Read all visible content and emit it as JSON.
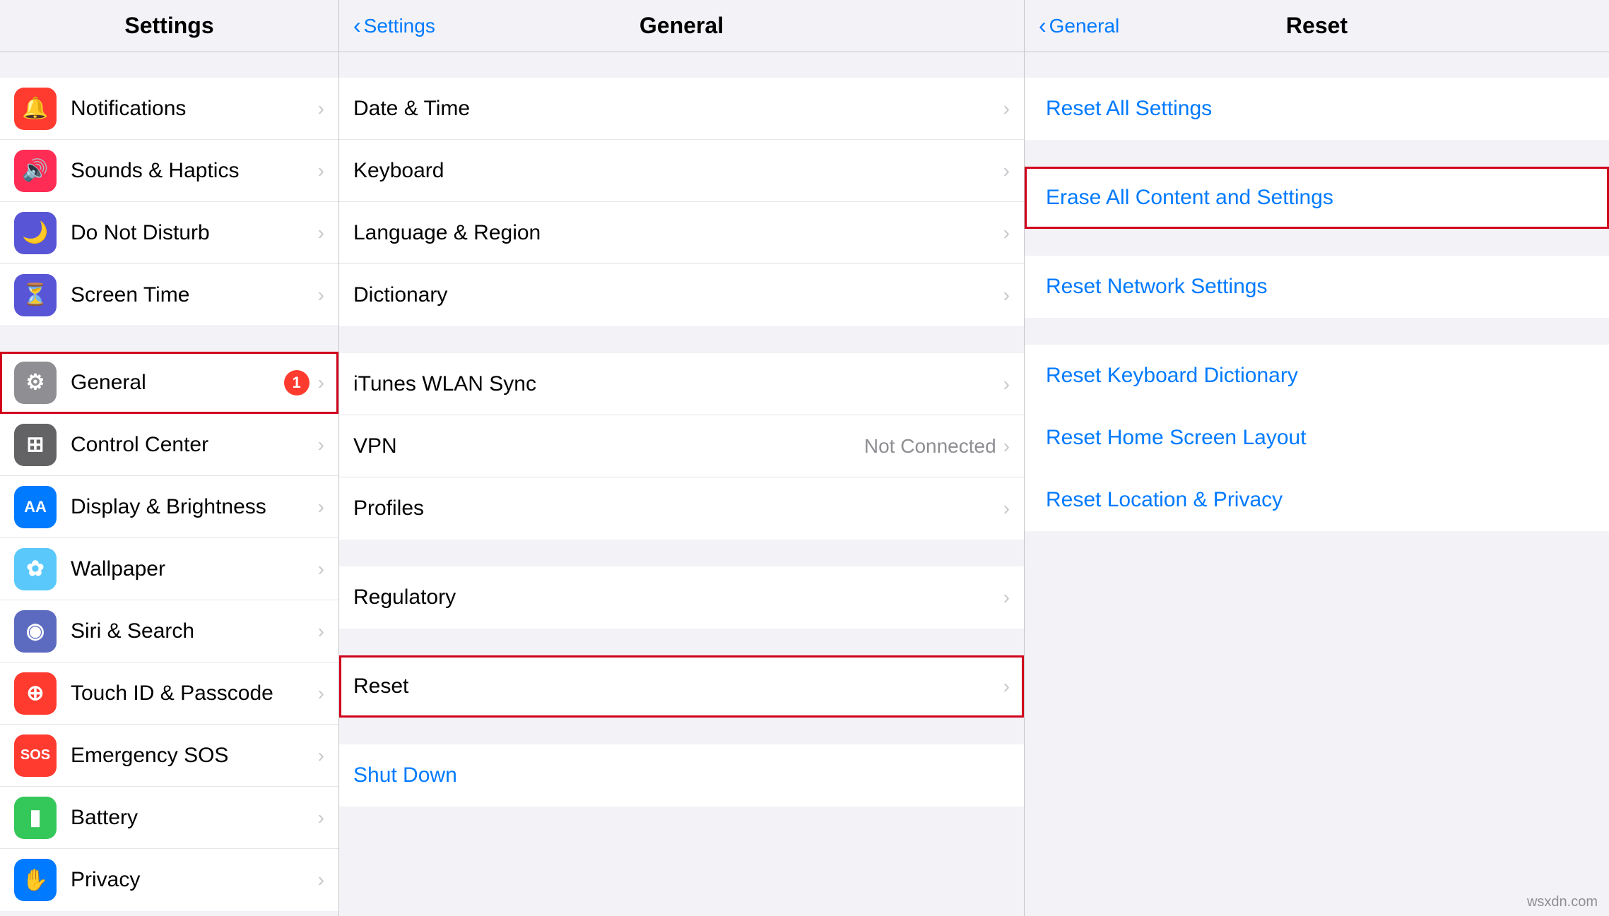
{
  "left_column": {
    "title": "Settings",
    "items": [
      {
        "id": "notifications",
        "label": "Notifications",
        "icon_color": "icon-red",
        "icon_char": "🔔",
        "badge": null,
        "selected": false
      },
      {
        "id": "sounds",
        "label": "Sounds & Haptics",
        "icon_color": "icon-pink",
        "icon_char": "🔊",
        "badge": null,
        "selected": false
      },
      {
        "id": "do-not-disturb",
        "label": "Do Not Disturb",
        "icon_color": "icon-indigo",
        "icon_char": "🌙",
        "badge": null,
        "selected": false
      },
      {
        "id": "screen-time",
        "label": "Screen Time",
        "icon_color": "icon-purple",
        "icon_char": "⏳",
        "badge": null,
        "selected": false
      },
      {
        "id": "general",
        "label": "General",
        "icon_color": "icon-gray",
        "icon_char": "⚙️",
        "badge": "1",
        "selected": true
      },
      {
        "id": "control-center",
        "label": "Control Center",
        "icon_color": "icon-dark-gray",
        "icon_char": "⚙",
        "badge": null,
        "selected": false
      },
      {
        "id": "display",
        "label": "Display & Brightness",
        "icon_color": "icon-blue",
        "icon_char": "AA",
        "badge": null,
        "selected": false
      },
      {
        "id": "wallpaper",
        "label": "Wallpaper",
        "icon_color": "icon-light-blue",
        "icon_char": "🌸",
        "badge": null,
        "selected": false
      },
      {
        "id": "siri",
        "label": "Siri & Search",
        "icon_color": "icon-dark-gray",
        "icon_char": "◉",
        "badge": null,
        "selected": false
      },
      {
        "id": "touch-id",
        "label": "Touch ID & Passcode",
        "icon_color": "icon-red",
        "icon_char": "☁",
        "badge": null,
        "selected": false
      },
      {
        "id": "emergency-sos",
        "label": "Emergency SOS",
        "icon_color": "icon-sos",
        "icon_char": "SOS",
        "badge": null,
        "selected": false
      },
      {
        "id": "battery",
        "label": "Battery",
        "icon_color": "icon-green",
        "icon_char": "▮",
        "badge": null,
        "selected": false
      },
      {
        "id": "privacy",
        "label": "Privacy",
        "icon_color": "icon-blue",
        "icon_char": "✋",
        "badge": null,
        "selected": false
      }
    ]
  },
  "middle_column": {
    "nav_back": "Settings",
    "title": "General",
    "items_top": [],
    "groups": [
      {
        "items": [
          {
            "id": "date-time",
            "label": "Date & Time",
            "value": "",
            "selected": false
          },
          {
            "id": "keyboard",
            "label": "Keyboard",
            "value": "",
            "selected": false
          },
          {
            "id": "language-region",
            "label": "Language & Region",
            "value": "",
            "selected": false
          },
          {
            "id": "dictionary",
            "label": "Dictionary",
            "value": "",
            "selected": false
          }
        ]
      },
      {
        "items": [
          {
            "id": "itunes-wlan",
            "label": "iTunes WLAN Sync",
            "value": "",
            "selected": false
          },
          {
            "id": "vpn",
            "label": "VPN",
            "value": "Not Connected",
            "selected": false
          },
          {
            "id": "profiles",
            "label": "Profiles",
            "value": "",
            "selected": false
          }
        ]
      },
      {
        "items": [
          {
            "id": "regulatory",
            "label": "Regulatory",
            "value": "",
            "selected": false
          }
        ]
      },
      {
        "items": [
          {
            "id": "reset",
            "label": "Reset",
            "value": "",
            "selected": true
          }
        ]
      }
    ],
    "bottom_items": [
      {
        "id": "shut-down",
        "label": "Shut Down",
        "is_action": true
      }
    ]
  },
  "right_column": {
    "nav_back": "General",
    "title": "Reset",
    "groups": [
      {
        "items": [
          {
            "id": "reset-all-settings",
            "label": "Reset All Settings",
            "highlighted": false
          }
        ]
      },
      {
        "items": [
          {
            "id": "erase-all",
            "label": "Erase All Content and Settings",
            "highlighted": true
          }
        ]
      },
      {
        "items": [
          {
            "id": "reset-network",
            "label": "Reset Network Settings",
            "highlighted": false
          }
        ]
      },
      {
        "items": [
          {
            "id": "reset-keyboard",
            "label": "Reset Keyboard Dictionary",
            "highlighted": false
          },
          {
            "id": "reset-home",
            "label": "Reset Home Screen Layout",
            "highlighted": false
          },
          {
            "id": "reset-location",
            "label": "Reset Location & Privacy",
            "highlighted": false
          }
        ]
      }
    ]
  },
  "watermark": "wsxdn.com"
}
